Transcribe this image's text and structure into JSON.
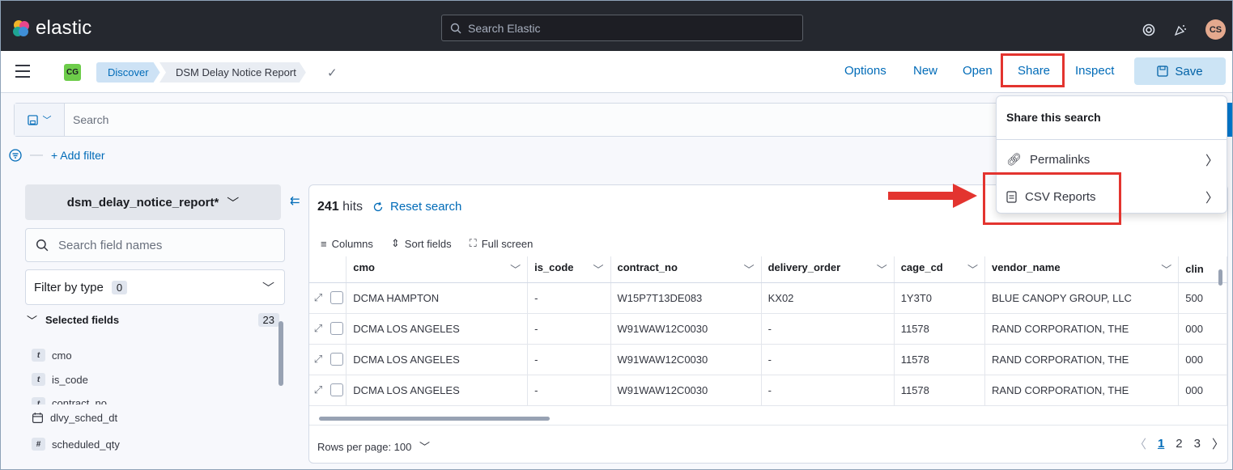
{
  "header": {
    "brand": "elastic",
    "search_placeholder": "Search Elastic",
    "avatar_initials": "CS"
  },
  "appbar": {
    "space_initials": "CG",
    "breadcrumbs": [
      "Discover",
      "DSM Delay Notice Report"
    ],
    "nav": [
      "Options",
      "New",
      "Open",
      "Share",
      "Inspect"
    ],
    "save_label": "Save"
  },
  "query": {
    "placeholder": "Search",
    "add_filter": "+ Add filter"
  },
  "sidebar": {
    "index_pattern": "dsm_delay_notice_report*",
    "field_search_placeholder": "Search field names",
    "filter_by_type": "Filter by type",
    "filter_count": "0",
    "selected_fields_label": "Selected fields",
    "selected_fields_count": "23",
    "fields": [
      {
        "type": "t",
        "name": "cmo"
      },
      {
        "type": "t",
        "name": "is_code"
      },
      {
        "type": "t",
        "name": "contract_no"
      },
      {
        "type": "date",
        "name": "dlvy_sched_dt"
      },
      {
        "type": "#",
        "name": "scheduled_qty"
      }
    ]
  },
  "grid": {
    "hits_count": "241",
    "hits_label": "hits",
    "reset_search": "Reset search",
    "toolbar": {
      "columns": "Columns",
      "sort_fields": "Sort fields",
      "full_screen": "Full screen"
    },
    "columns": [
      "cmo",
      "is_code",
      "contract_no",
      "delivery_order",
      "cage_cd",
      "vendor_name",
      "clin"
    ],
    "rows": [
      [
        "DCMA HAMPTON",
        "-",
        "W15P7T13DE083",
        "KX02",
        "1Y3T0",
        "BLUE CANOPY GROUP, LLC",
        "500"
      ],
      [
        "DCMA LOS ANGELES",
        "-",
        "W91WAW12C0030",
        "-",
        "11578",
        "RAND CORPORATION, THE",
        "000"
      ],
      [
        "DCMA LOS ANGELES",
        "-",
        "W91WAW12C0030",
        "-",
        "11578",
        "RAND CORPORATION, THE",
        "000"
      ],
      [
        "DCMA LOS ANGELES",
        "-",
        "W91WAW12C0030",
        "-",
        "11578",
        "RAND CORPORATION, THE",
        "000"
      ]
    ],
    "rows_per_page": "Rows per page: 100",
    "pages": [
      "1",
      "2",
      "3"
    ]
  },
  "share_menu": {
    "title": "Share this search",
    "items": [
      "Permalinks",
      "CSV Reports"
    ]
  },
  "colors": {
    "header_bg": "#25282f",
    "link": "#006bb8",
    "highlight": "#e3342f"
  }
}
